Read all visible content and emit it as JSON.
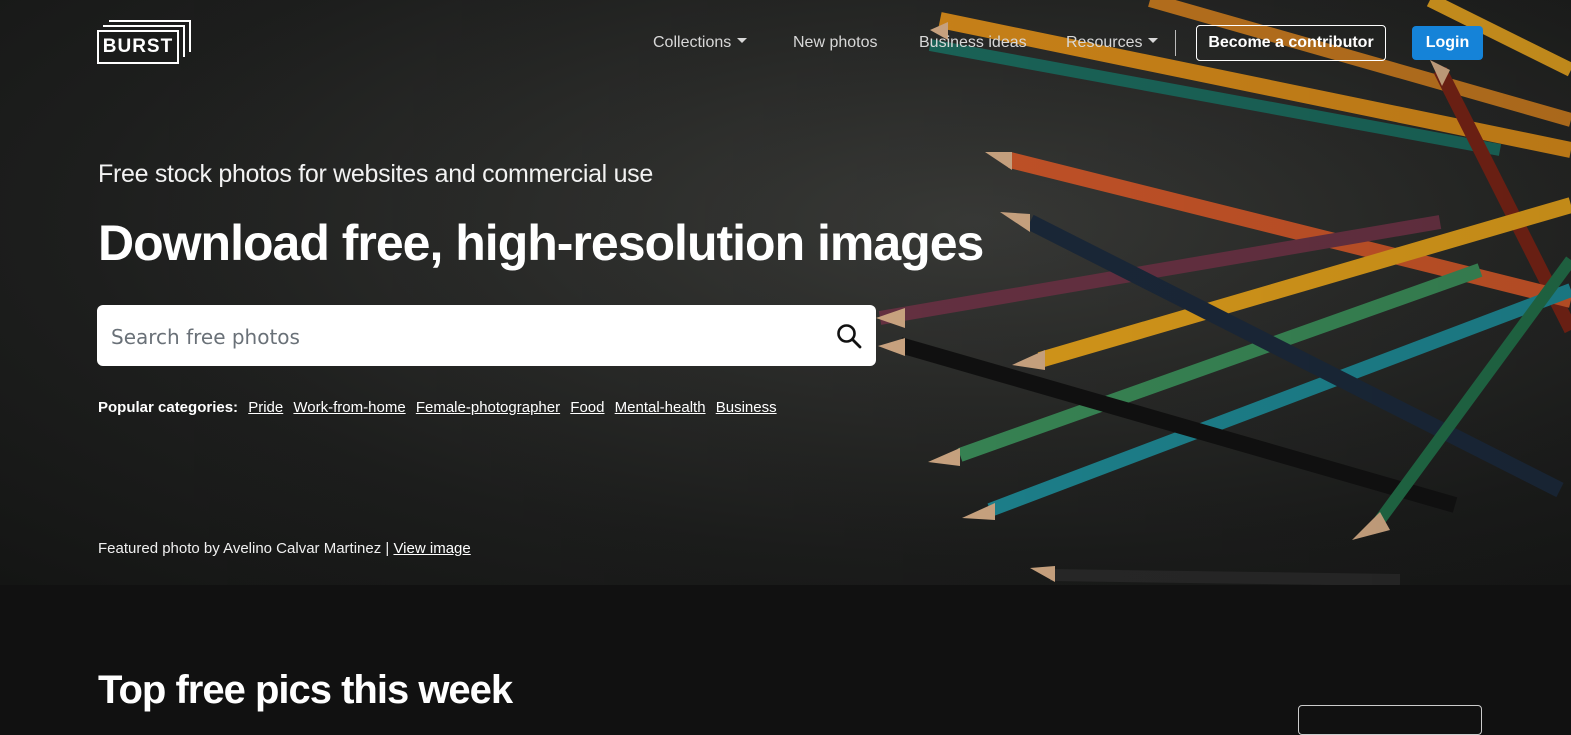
{
  "brand": {
    "logo_text": "BURST"
  },
  "nav": {
    "items": [
      {
        "label": "Collections",
        "dropdown": true
      },
      {
        "label": "New photos",
        "dropdown": false
      },
      {
        "label": "Business ideas",
        "dropdown": false
      },
      {
        "label": "Resources",
        "dropdown": true
      }
    ],
    "contributor_label": "Become a contributor",
    "login_label": "Login"
  },
  "hero": {
    "tagline": "Free stock photos for websites and commercial use",
    "headline": "Download free, high-resolution images",
    "search": {
      "placeholder": "Search free photos",
      "value": ""
    },
    "popular": {
      "label": "Popular categories:",
      "categories": [
        "Pride",
        "Work-from-home",
        "Female-photographer",
        "Food",
        "Mental-health",
        "Business"
      ]
    },
    "credit": {
      "text": "Featured photo by Avelino Calvar Martinez |",
      "link": "View image"
    }
  },
  "section": {
    "title": "Top free pics this week"
  },
  "colors": {
    "accent": "#1583d8",
    "background": "#111111"
  }
}
